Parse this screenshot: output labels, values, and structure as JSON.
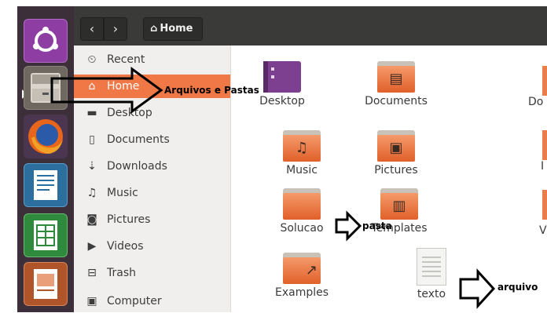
{
  "header": {
    "back_icon": "chevron-left-icon",
    "forward_icon": "chevron-right-icon",
    "path_label": "Home"
  },
  "sidebar": {
    "items": [
      {
        "icon": "clock-icon",
        "glyph": "⏲",
        "label": "Recent"
      },
      {
        "icon": "home-icon",
        "glyph": "⌂",
        "label": "Home",
        "active": true
      },
      {
        "icon": "desktop-folder-icon",
        "glyph": "▬",
        "label": "Desktop"
      },
      {
        "icon": "document-icon",
        "glyph": "▯",
        "label": "Documents"
      },
      {
        "icon": "download-icon",
        "glyph": "⇣",
        "label": "Downloads"
      },
      {
        "icon": "music-icon",
        "glyph": "♫",
        "label": "Music"
      },
      {
        "icon": "camera-icon",
        "glyph": "◙",
        "label": "Pictures"
      },
      {
        "icon": "video-icon",
        "glyph": "▶",
        "label": "Videos"
      },
      {
        "icon": "trash-icon",
        "glyph": "⊟",
        "label": "Trash"
      },
      {
        "icon": "computer-icon",
        "glyph": "▣",
        "label": "Computer"
      }
    ]
  },
  "files": [
    {
      "label": "Desktop",
      "icon": "desktop-folder-icon"
    },
    {
      "label": "Documents",
      "icon": "documents-folder-icon"
    },
    {
      "label": "Music",
      "icon": "music-folder-icon"
    },
    {
      "label": "Pictures",
      "icon": "pictures-folder-icon"
    },
    {
      "label": "Solucao",
      "icon": "folder-icon"
    },
    {
      "label": "Templates",
      "icon": "templates-folder-icon"
    },
    {
      "label": "Examples",
      "icon": "examples-folder-icon"
    },
    {
      "label": "texto",
      "icon": "text-file-icon"
    }
  ],
  "partial_labels": {
    "row1": "Do",
    "row2": "I",
    "row3": "V"
  },
  "annotations": {
    "home": "Arquivos e Pastas",
    "folder": "pasta",
    "file": "arquivo"
  },
  "launcher": [
    "ubuntu-logo-icon",
    "files-app-icon",
    "firefox-icon",
    "libreoffice-writer-icon",
    "libreoffice-calc-icon",
    "libreoffice-impress-icon"
  ],
  "colors": {
    "accent": "#f07746",
    "header": "#3a3a38",
    "launcher": "#3c2f3a",
    "sidebar": "#f0efed"
  }
}
